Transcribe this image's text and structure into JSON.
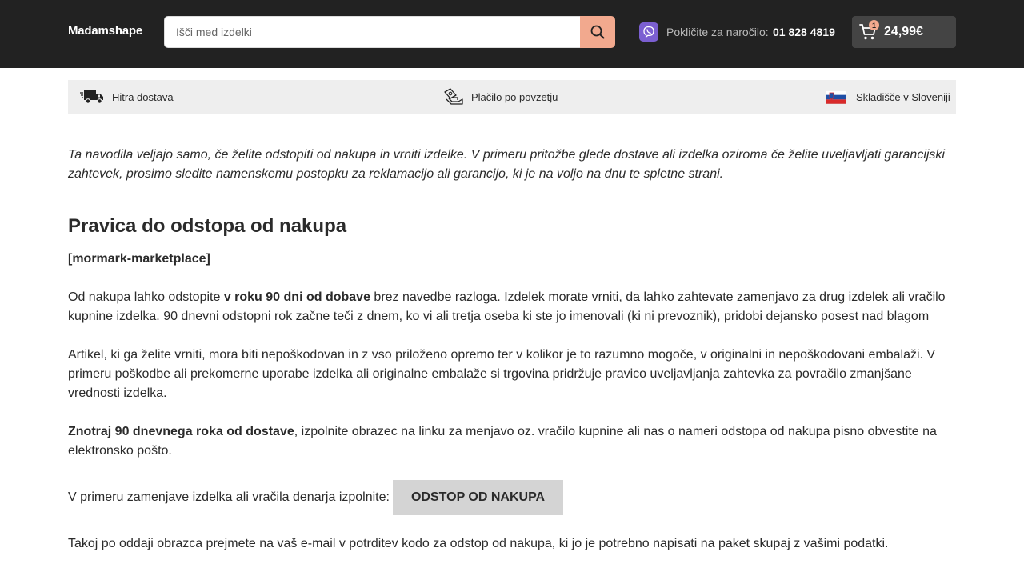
{
  "header": {
    "logo": "Madamshape",
    "search_placeholder": "Išči med izdelki",
    "phone_label": "Pokličite za naročilo:",
    "phone_number": "01 828 4819",
    "cart_count": "1",
    "cart_total": "24,99€",
    "icons": {
      "search": "search-icon",
      "viber": "viber-icon",
      "cart": "cart-icon"
    },
    "colors": {
      "header_bg": "#222222",
      "search_button": "#f2a98e",
      "viber": "#7b5fd1",
      "cart_bg": "#444444"
    }
  },
  "benefits": [
    {
      "icon": "delivery-truck-icon",
      "label": "Hitra dostava"
    },
    {
      "icon": "cash-payment-icon",
      "label": "Plačilo po povzetju"
    },
    {
      "icon": "slovenia-flag-icon",
      "label": "Skladišče v Sloveniji"
    }
  ],
  "content": {
    "intro": "Ta navodila veljajo samo, če želite odstopiti od nakupa in vrniti izdelke. V primeru pritožbe glede dostave ali izdelka oziroma če želite uveljavljati garancijski zahtevek, prosimo sledite namenskemu postopku za reklamacijo ali garancijo, ki je na voljo na dnu te spletne strani.",
    "heading": "Pravica do odstopa od nakupa",
    "shortcode": "[mormark-marketplace]",
    "p1_before": "Od nakupa lahko odstopite ",
    "p1_bold": "v roku 90 dni od dobave",
    "p1_after": " brez navedbe razloga. Izdelek morate vrniti, da lahko zahtevate zamenjavo za drug izdelek ali vračilo kupnine izdelka. 90 dnevni odstopni rok začne teči z dnem, ko vi ali tretja oseba ki ste jo imenovali (ki ni prevoznik), pridobi dejansko posest nad blagom",
    "p2": "Artikel, ki ga želite vrniti, mora biti nepoškodovan in z vso priloženo opremo ter v kolikor je to razumno mogoče, v originalni in nepoškodovani embalaži. V primeru poškodbe ali prekomerne uporabe izdelka ali originalne embalaže si trgovina pridržuje pravico uveljavljanja zahtevka za povračilo zmanjšane vrednosti izdelka.",
    "p3_bold": "Znotraj 90 dnevnega roka od dostave",
    "p3_after": ", izpolnite obrazec na linku za menjavo oz. vračilo kupnine ali nas o nameri odstopa od nakupa pisno obvestite na elektronsko pošto.",
    "action_label": "V primeru zamenjave izdelka ali vračila denarja izpolnite:",
    "action_button": "ODSTOP OD NAKUPA",
    "p_last": "Takoj po oddaji obrazca prejmete na vaš e-mail v potrditev kodo za odstop od nakupa, ki jo je potrebno napisati na paket skupaj z vašimi podatki."
  }
}
